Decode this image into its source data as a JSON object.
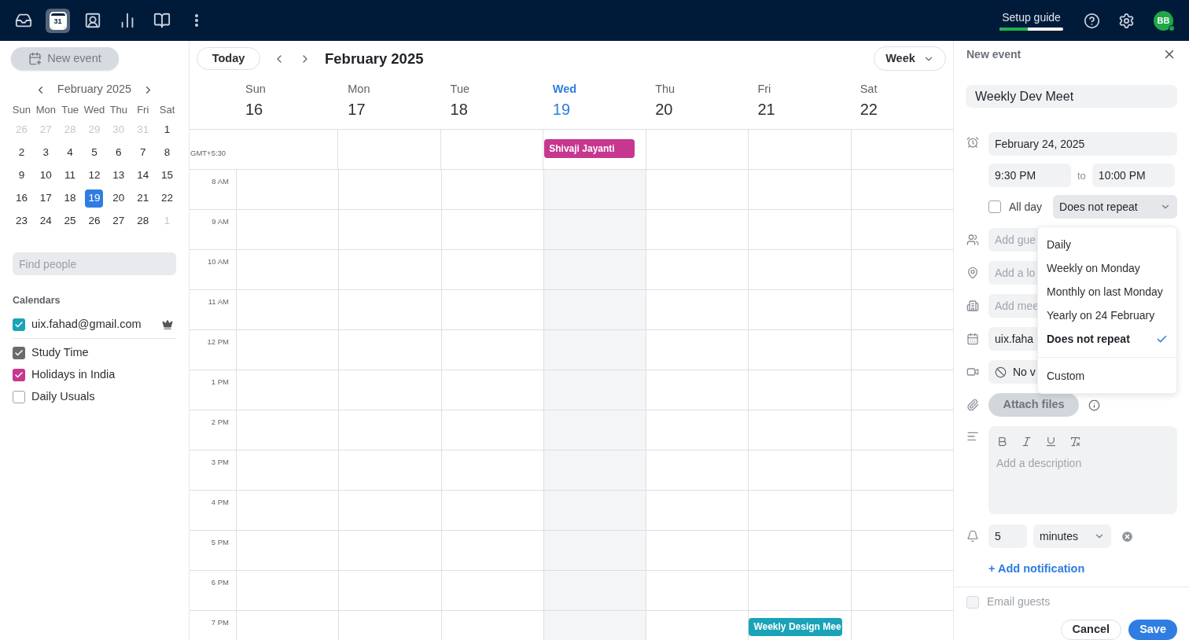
{
  "top_bar": {
    "apps": [
      {
        "kind": "inbox",
        "selected": false
      },
      {
        "kind": "calendar",
        "label": "31",
        "selected": true
      },
      {
        "kind": "contacts",
        "selected": false
      },
      {
        "kind": "stats",
        "selected": false
      },
      {
        "kind": "reader",
        "selected": false
      },
      {
        "kind": "more",
        "selected": false
      }
    ],
    "setup_guide": {
      "label": "Setup guide",
      "level": 0.45
    },
    "avatar": "BB"
  },
  "sidebar": {
    "new_event": "New event",
    "mini_calendar": {
      "month": "February 2025",
      "weekdays": [
        "Sun",
        "Mon",
        "Tue",
        "Wed",
        "Thu",
        "Fri",
        "Sat"
      ],
      "weeks": [
        [
          {
            "day": "26",
            "muted": true,
            "selected": false
          },
          {
            "day": "27",
            "muted": true,
            "selected": false
          },
          {
            "day": "28",
            "muted": true,
            "selected": false
          },
          {
            "day": "29",
            "muted": true,
            "selected": false
          },
          {
            "day": "30",
            "muted": true,
            "selected": false
          },
          {
            "day": "31",
            "muted": true,
            "selected": false
          },
          {
            "day": "1",
            "muted": false,
            "selected": false
          }
        ],
        [
          {
            "day": "2",
            "muted": false,
            "selected": false
          },
          {
            "day": "3",
            "muted": false,
            "selected": false
          },
          {
            "day": "4",
            "muted": false,
            "selected": false
          },
          {
            "day": "5",
            "muted": false,
            "selected": false
          },
          {
            "day": "6",
            "muted": false,
            "selected": false
          },
          {
            "day": "7",
            "muted": false,
            "selected": false
          },
          {
            "day": "8",
            "muted": false,
            "selected": false
          }
        ],
        [
          {
            "day": "9",
            "muted": false,
            "selected": false
          },
          {
            "day": "10",
            "muted": false,
            "selected": false
          },
          {
            "day": "11",
            "muted": false,
            "selected": false
          },
          {
            "day": "12",
            "muted": false,
            "selected": false
          },
          {
            "day": "13",
            "muted": false,
            "selected": false
          },
          {
            "day": "14",
            "muted": false,
            "selected": false
          },
          {
            "day": "15",
            "muted": false,
            "selected": false
          }
        ],
        [
          {
            "day": "16",
            "muted": false,
            "selected": false
          },
          {
            "day": "17",
            "muted": false,
            "selected": false
          },
          {
            "day": "18",
            "muted": false,
            "selected": false
          },
          {
            "day": "19",
            "muted": false,
            "selected": true
          },
          {
            "day": "20",
            "muted": false,
            "selected": false
          },
          {
            "day": "21",
            "muted": false,
            "selected": false
          },
          {
            "day": "22",
            "muted": false,
            "selected": false
          }
        ],
        [
          {
            "day": "23",
            "muted": false,
            "selected": false
          },
          {
            "day": "24",
            "muted": false,
            "selected": false
          },
          {
            "day": "25",
            "muted": false,
            "selected": false
          },
          {
            "day": "26",
            "muted": false,
            "selected": false
          },
          {
            "day": "27",
            "muted": false,
            "selected": false
          },
          {
            "day": "28",
            "muted": false,
            "selected": false
          },
          {
            "day": "1",
            "muted": true,
            "selected": false
          }
        ]
      ]
    },
    "find_people": {
      "placeholder": "Find people"
    },
    "calendars_heading": "Calendars",
    "calendars": [
      {
        "kind": "owner",
        "name": "uix.fahad@gmail.com",
        "checked": true,
        "color": "#1aa3b8"
      },
      {
        "kind": "other",
        "name": "Study Time",
        "checked": true,
        "color": "#6b6b6f"
      },
      {
        "kind": "other",
        "name": "Holidays in India",
        "checked": true,
        "color": "#c7368f"
      },
      {
        "kind": "other",
        "name": "Daily Usuals",
        "checked": false
      }
    ]
  },
  "calendar": {
    "today_button": "Today",
    "title": "February 2025",
    "view": "Week",
    "timezone": "GMT+5:30",
    "days": [
      {
        "name": "Sun",
        "date": "16",
        "selected": false
      },
      {
        "name": "Mon",
        "date": "17",
        "selected": false
      },
      {
        "name": "Tue",
        "date": "18",
        "selected": false
      },
      {
        "name": "Wed",
        "date": "19",
        "selected": true,
        "all_day_events": [
          {
            "title": "Shivaji Jayanti",
            "color": "#c7368f"
          }
        ]
      },
      {
        "name": "Thu",
        "date": "20",
        "selected": false
      },
      {
        "name": "Fri",
        "date": "21",
        "selected": false
      },
      {
        "name": "Sat",
        "date": "22",
        "selected": false
      }
    ],
    "hours": [
      {
        "label": "8 AM"
      },
      {
        "label": "9 AM"
      },
      {
        "label": "10 AM"
      },
      {
        "label": "11 AM"
      },
      {
        "label": "12 PM"
      },
      {
        "label": "1 PM"
      },
      {
        "label": "2 PM"
      },
      {
        "label": "3 PM"
      },
      {
        "label": "4 PM"
      },
      {
        "label": "5 PM"
      },
      {
        "label": "6 PM"
      },
      {
        "label": "7 PM",
        "cells": [
          {},
          {},
          {},
          {},
          {},
          {
            "event": {
              "title": "Weekly Design Mee",
              "color": "#1aa3b8"
            }
          },
          {}
        ]
      }
    ]
  },
  "event_panel": {
    "title": "New event",
    "event_title": "Weekly Dev Meet",
    "date": "February 24, 2025",
    "start": "9:30 PM",
    "to": "to",
    "end": "10:00 PM",
    "all_day": {
      "label": "All day",
      "checked": false
    },
    "repeat": "Does not repeat",
    "fields": [
      {
        "kind": "guests",
        "placeholder": "Add gue"
      },
      {
        "kind": "location",
        "placeholder": "Add a lo"
      },
      {
        "kind": "room",
        "placeholder": "Add mee"
      },
      {
        "kind": "calendar",
        "value": "uix.faha"
      },
      {
        "kind": "video",
        "value": "No v"
      }
    ],
    "attach": "Attach files",
    "description": {
      "placeholder": "Add a description"
    },
    "notification": {
      "value": "5",
      "unit": "minutes"
    },
    "add_notification": "+ Add notification",
    "email_guests": {
      "label": "Email guests",
      "checked": false,
      "disabled": true
    },
    "buttons": [
      {
        "kind": "secondary",
        "label": "Cancel"
      },
      {
        "kind": "primary",
        "label": "Save"
      }
    ],
    "repeat_menu": [
      {
        "kind": "preset",
        "label": "Daily",
        "selected": false
      },
      {
        "kind": "preset",
        "label": "Weekly on Monday",
        "selected": false
      },
      {
        "kind": "preset",
        "label": "Monthly on last Monday",
        "selected": false
      },
      {
        "kind": "preset",
        "label": "Yearly on 24 February",
        "selected": false
      },
      {
        "kind": "preset",
        "label": "Does not repeat",
        "selected": true
      },
      {
        "kind": "custom",
        "label": "Custom",
        "selected": false
      }
    ]
  }
}
